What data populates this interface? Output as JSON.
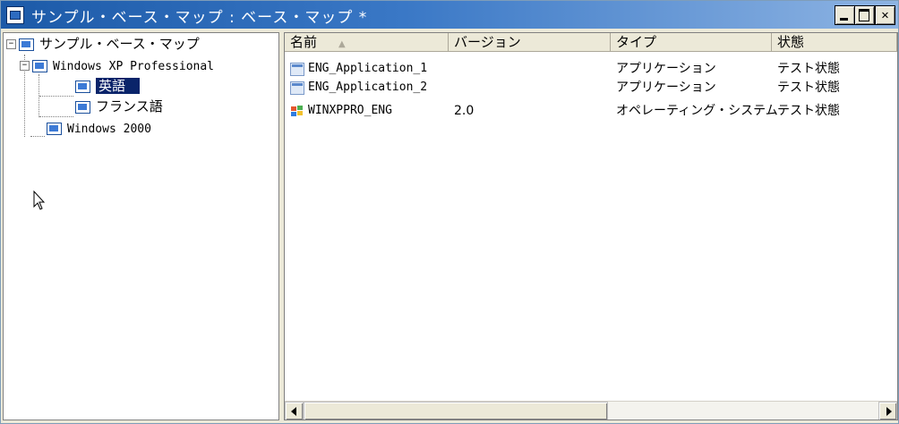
{
  "window": {
    "title": "サンプル・ベース・マップ : ベース・マップ *"
  },
  "tree": {
    "root": {
      "label": "サンプル・ベース・マップ",
      "expanded": true
    },
    "nodes": [
      {
        "label": "Windows XP Professional",
        "expanded": true
      },
      {
        "label": "英語",
        "selected": true
      },
      {
        "label": "フランス語"
      },
      {
        "label": "Windows 2000"
      }
    ]
  },
  "list": {
    "columns": [
      "名前",
      "バージョン",
      "タイプ",
      "状態"
    ],
    "rows": [
      {
        "icon": "application-icon",
        "name": "ENG_Application_1",
        "version": "",
        "type": "アプリケーション",
        "status": "テスト状態"
      },
      {
        "icon": "application-icon",
        "name": "ENG_Application_2",
        "version": "",
        "type": "アプリケーション",
        "status": "テスト状態"
      },
      {
        "icon": "windows-os-icon",
        "name": "WINXPPRO_ENG",
        "version": "2.0",
        "type": "オペレーティング・システム",
        "status": "テスト状態"
      }
    ]
  },
  "colors": {
    "titlebar": "#1c5aa8",
    "selection": "#0a246a"
  }
}
